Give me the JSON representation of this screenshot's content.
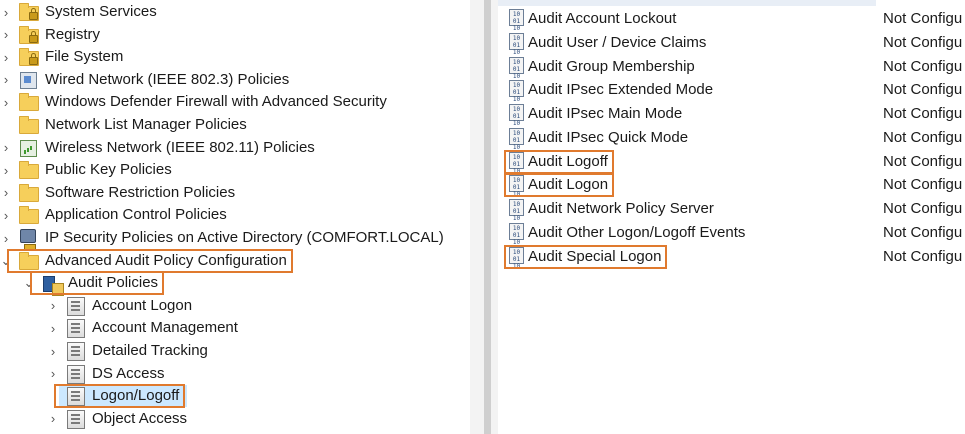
{
  "tree": {
    "items": [
      {
        "label": "System Services",
        "icon": "folder-lock-icon",
        "chevron": "›",
        "level": 0
      },
      {
        "label": "Registry",
        "icon": "folder-lock-icon",
        "chevron": "›",
        "level": 0
      },
      {
        "label": "File System",
        "icon": "folder-lock-icon",
        "chevron": "›",
        "level": 0
      },
      {
        "label": "Wired Network (IEEE 802.3) Policies",
        "icon": "network-icon",
        "chevron": "›",
        "level": 0
      },
      {
        "label": "Windows Defender Firewall with Advanced Security",
        "icon": "folder-icon",
        "chevron": "›",
        "level": 0
      },
      {
        "label": "Network List Manager Policies",
        "icon": "folder-icon",
        "chevron": "",
        "level": 0
      },
      {
        "label": "Wireless Network (IEEE 802.11) Policies",
        "icon": "wireless-icon",
        "chevron": "›",
        "level": 0
      },
      {
        "label": "Public Key Policies",
        "icon": "folder-icon",
        "chevron": "›",
        "level": 0
      },
      {
        "label": "Software Restriction Policies",
        "icon": "folder-icon",
        "chevron": "›",
        "level": 0
      },
      {
        "label": "Application Control Policies",
        "icon": "folder-icon",
        "chevron": "›",
        "level": 0
      },
      {
        "label": "IP Security Policies on Active Directory (COMFORT.LOCAL)",
        "icon": "ipsec-icon",
        "chevron": "›",
        "level": 0
      },
      {
        "label": "Advanced Audit Policy Configuration",
        "icon": "folder-icon",
        "chevron": "⌄",
        "level": 0,
        "highlighted": true
      },
      {
        "label": "Audit Policies",
        "icon": "audit-policies-icon",
        "chevron": "⌄",
        "level": 1,
        "highlighted": true
      },
      {
        "label": "Account Logon",
        "icon": "category-icon",
        "chevron": "›",
        "level": 2
      },
      {
        "label": "Account Management",
        "icon": "category-icon",
        "chevron": "›",
        "level": 2
      },
      {
        "label": "Detailed Tracking",
        "icon": "category-icon",
        "chevron": "›",
        "level": 2
      },
      {
        "label": "DS Access",
        "icon": "category-icon",
        "chevron": "›",
        "level": 2
      },
      {
        "label": "Logon/Logoff",
        "icon": "category-icon",
        "chevron": "",
        "level": 2,
        "selected": true,
        "highlighted": true
      },
      {
        "label": "Object Access",
        "icon": "category-icon",
        "chevron": "›",
        "level": 2
      }
    ]
  },
  "list": {
    "rows": [
      {
        "name": "Audit Account Lockout",
        "status": "Not Configu"
      },
      {
        "name": "Audit User / Device Claims",
        "status": "Not Configu"
      },
      {
        "name": "Audit Group Membership",
        "status": "Not Configu"
      },
      {
        "name": "Audit IPsec Extended Mode",
        "status": "Not Configu"
      },
      {
        "name": "Audit IPsec Main Mode",
        "status": "Not Configu"
      },
      {
        "name": "Audit IPsec Quick Mode",
        "status": "Not Configu"
      },
      {
        "name": "Audit Logoff",
        "status": "Not Configu",
        "highlighted": true
      },
      {
        "name": "Audit Logon",
        "status": "Not Configu",
        "highlighted": true
      },
      {
        "name": "Audit Network Policy Server",
        "status": "Not Configu"
      },
      {
        "name": "Audit Other Logon/Logoff Events",
        "status": "Not Configu"
      },
      {
        "name": "Audit Special Logon",
        "status": "Not Configu",
        "highlighted": true
      }
    ]
  },
  "colors": {
    "highlight": "#e07a2e",
    "selection": "#cce8ff"
  }
}
